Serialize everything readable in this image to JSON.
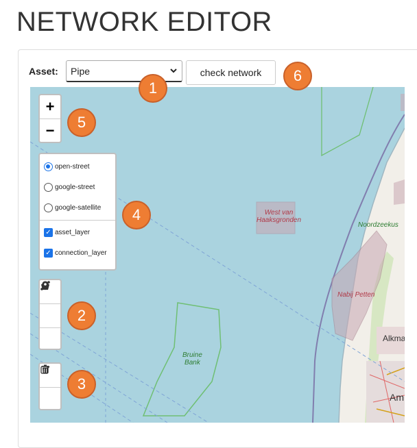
{
  "page": {
    "title": "NETWORK EDITOR"
  },
  "toolbar": {
    "asset_label": "Asset:",
    "asset_value": "Pipe",
    "check_label": "check network"
  },
  "zoom": {
    "in": "+",
    "out": "−"
  },
  "layers": {
    "base": [
      {
        "label": "open-street",
        "selected": true
      },
      {
        "label": "google-street",
        "selected": false
      },
      {
        "label": "google-satellite",
        "selected": false
      }
    ],
    "overlays": [
      {
        "label": "asset_layer",
        "checked": true
      },
      {
        "label": "connection_layer",
        "checked": true
      }
    ]
  },
  "draw_tools": [
    "polyline-icon",
    "polygon-icon",
    "marker-icon"
  ],
  "edit_tools": [
    "edit-icon",
    "trash-icon"
  ],
  "callouts": {
    "c1": "1",
    "c2": "2",
    "c3": "3",
    "c4": "4",
    "c5": "5",
    "c6": "6"
  },
  "map_labels": {
    "west": "West van\nHaaksgronden",
    "noordzee": "Noordzeekus",
    "petten": "Nabij Petten",
    "bruine": "Bruine\nBank",
    "alkmaar": "Alkma",
    "amsterdam": "Am"
  },
  "colors": {
    "sea": "#aad3df",
    "callout": "#ee7d33",
    "land": "#f2efe9",
    "protected_area": "#c8a7b3"
  }
}
